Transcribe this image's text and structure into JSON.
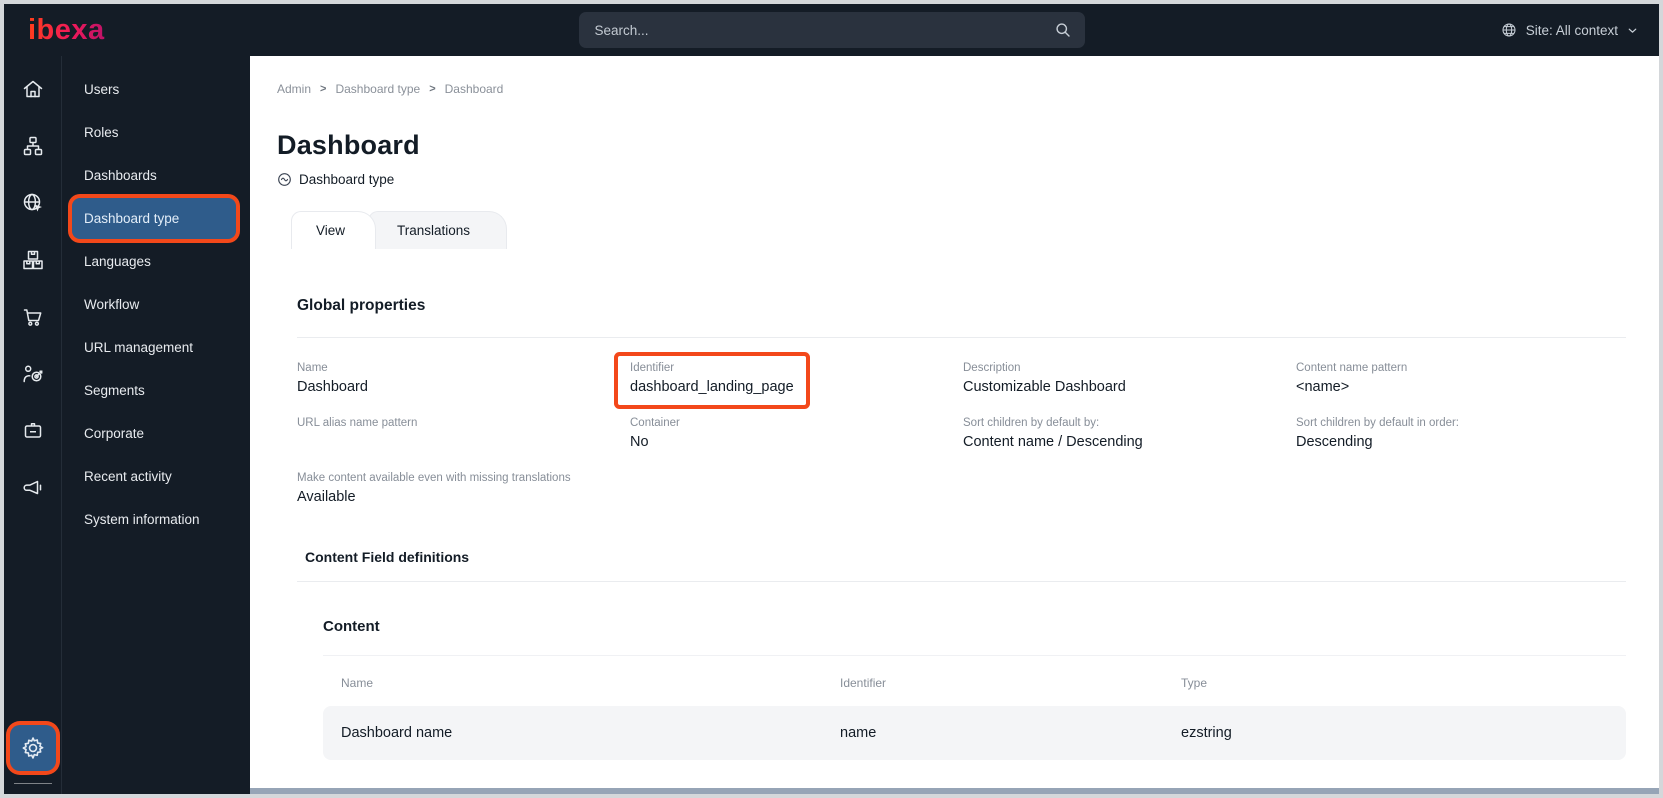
{
  "topbar": {
    "logo": "ibexa",
    "search_placeholder": "Search...",
    "site_label": "Site: All context"
  },
  "icons": {
    "rail": [
      "home",
      "content-tree",
      "site-globe",
      "product-boxes",
      "commerce-cart",
      "personalization-target",
      "corporate-badge",
      "marketing-megaphone"
    ],
    "rail_bottom": "settings-gear",
    "topbar": [
      "search",
      "globe",
      "chevron-down"
    ],
    "subtitle": "content-type"
  },
  "sidebar": {
    "items": [
      {
        "label": "Users",
        "active": false
      },
      {
        "label": "Roles",
        "active": false
      },
      {
        "label": "Dashboards",
        "active": false
      },
      {
        "label": "Dashboard type",
        "active": true
      },
      {
        "label": "Languages",
        "active": false
      },
      {
        "label": "Workflow",
        "active": false
      },
      {
        "label": "URL management",
        "active": false
      },
      {
        "label": "Segments",
        "active": false
      },
      {
        "label": "Corporate",
        "active": false
      },
      {
        "label": "Recent activity",
        "active": false
      },
      {
        "label": "System information",
        "active": false
      }
    ]
  },
  "breadcrumb": [
    "Admin",
    "Dashboard type",
    "Dashboard"
  ],
  "page": {
    "title": "Dashboard",
    "type_label": "Dashboard type"
  },
  "tabs": [
    {
      "label": "View",
      "active": true
    },
    {
      "label": "Translations",
      "active": false
    }
  ],
  "global_properties": {
    "heading": "Global properties",
    "fields": [
      {
        "label": "Name",
        "value": "Dashboard"
      },
      {
        "label": "Identifier",
        "value": "dashboard_landing_page",
        "highlighted": true
      },
      {
        "label": "Description",
        "value": "Customizable Dashboard"
      },
      {
        "label": "Content name pattern",
        "value": "<name>"
      },
      {
        "label": "URL alias name pattern",
        "value": ""
      },
      {
        "label": "Container",
        "value": "No"
      },
      {
        "label": "Sort children by default by:",
        "value": "Content name / Descending"
      },
      {
        "label": "Sort children by default in order:",
        "value": "Descending"
      },
      {
        "label": "Make content available even with missing translations",
        "value": "Available"
      }
    ]
  },
  "field_definitions": {
    "heading": "Content Field definitions",
    "group_heading": "Content",
    "table": {
      "headers": [
        "Name",
        "Identifier",
        "Type"
      ],
      "rows": [
        [
          "Dashboard name",
          "name",
          "ezstring"
        ]
      ]
    }
  },
  "colors": {
    "dark": "#141C26",
    "accent_orange": "#F3481A",
    "selected_blue": "#2F5C8B",
    "text_dark": "#131C26",
    "text_gray": "#878E98",
    "row_bg": "#F4F5F7"
  }
}
